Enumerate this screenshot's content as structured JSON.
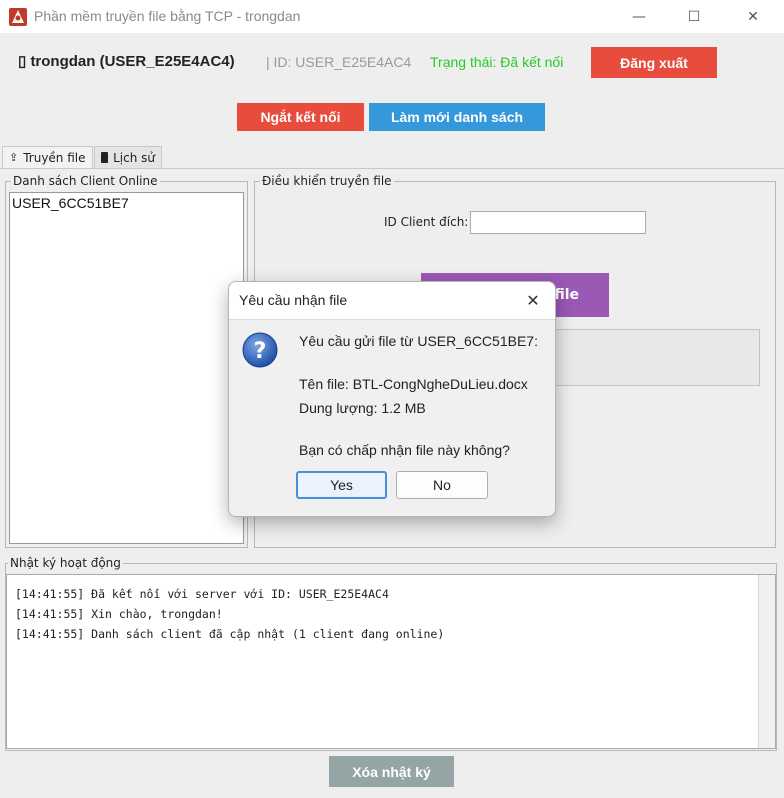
{
  "window": {
    "title": "Phần mềm truyền file bằng TCP - trongdan",
    "controls": {
      "minimize": "—",
      "maximize": "☐",
      "close": "✕"
    }
  },
  "header": {
    "user_icon": "▯",
    "user_name": "trongdan (USER_E25E4AC4)",
    "user_id": "| ID: USER_E25E4AC4",
    "status": "Trạng thái: Đã kết nối",
    "logout_label": "Đăng xuất"
  },
  "actions": {
    "disconnect_label": "Ngắt kết nối",
    "refresh_label": "Làm mới danh sách"
  },
  "tabs": [
    {
      "label": "Truyền file",
      "icon": "upload-icon",
      "active": true
    },
    {
      "label": "Lịch sử",
      "icon": "clipboard-icon",
      "active": false
    }
  ],
  "clients": {
    "title": "Danh sách Client Online",
    "items": [
      "USER_6CC51BE7"
    ]
  },
  "transfer": {
    "title": "Điều khiển truyền file",
    "target_label": "ID Client đích:",
    "target_value": "",
    "send_button_visible": "file"
  },
  "log": {
    "title": "Nhật ký hoạt động",
    "lines": [
      "[14:41:55] Đã kết nối với server với ID: USER_E25E4AC4",
      "[14:41:55] Xin chào, trongdan!",
      "[14:41:55] Danh sách client đã cập nhật (1 client đang online)"
    ],
    "clear_label": "Xóa nhật ký"
  },
  "dialog": {
    "title": "Yêu cầu nhận file",
    "close": "✕",
    "message": "Yêu cầu gửi file từ USER_6CC51BE7:",
    "file_name": "Tên file: BTL-CongNgheDuLieu.docx",
    "file_size": "Dung lượng: 1.2 MB",
    "question": "Bạn có chấp nhận file này không?",
    "yes_label": "Yes",
    "no_label": "No"
  },
  "colors": {
    "status_green": "#22cc22",
    "danger_red": "#e74c3c",
    "primary_blue": "#3498db",
    "purple": "#9b59b6",
    "muted_gray": "#95a5a6"
  }
}
